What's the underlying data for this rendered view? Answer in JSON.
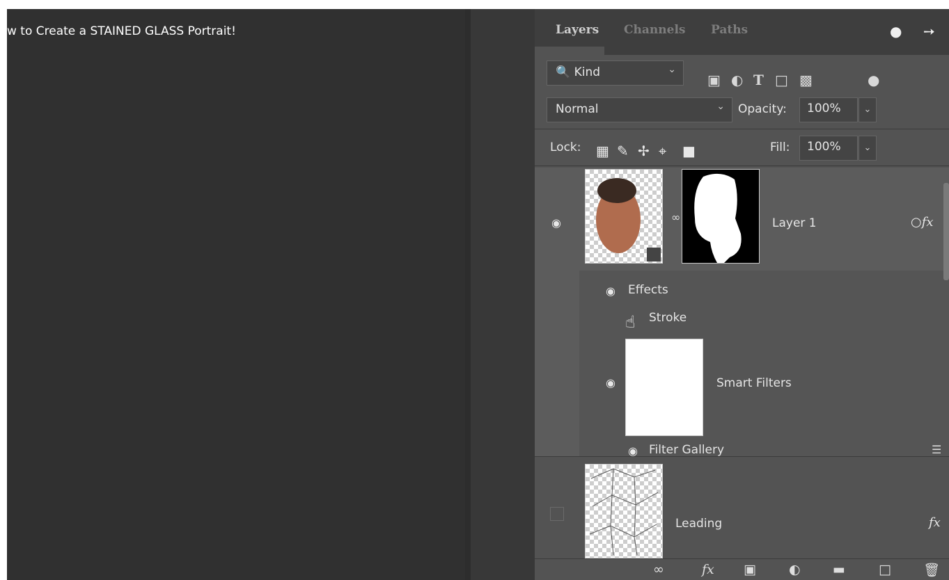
{
  "video": {
    "title": "w to Create a STAINED GLASS Portrait!"
  },
  "panel": {
    "tabs": [
      {
        "label": "Layers",
        "active": true
      },
      {
        "label": "Channels",
        "active": false
      },
      {
        "label": "Paths",
        "active": false
      }
    ],
    "header_icons": [
      "clock-icon",
      "share-arrow-icon"
    ],
    "filter": {
      "kind_label": "Kind",
      "filter_icons": [
        "pixel-layer-filter-icon",
        "adjustment-layer-filter-icon",
        "type-layer-filter-icon",
        "shape-layer-filter-icon",
        "smart-object-filter-icon",
        "filter-toggle-icon"
      ]
    },
    "blend": {
      "mode": "Normal",
      "opacity_label": "Opacity:",
      "opacity_value": "100%"
    },
    "lock": {
      "label": "Lock:",
      "fill_label": "Fill:",
      "fill_value": "100%",
      "icons": [
        "lock-transparent-pixels-icon",
        "lock-image-pixels-icon",
        "lock-position-icon",
        "lock-artboard-icon",
        "lock-all-icon"
      ]
    },
    "layers": [
      {
        "name": "Layer 1",
        "visible": true,
        "has_mask": true,
        "has_fx": true,
        "effects_label": "Effects",
        "stroke_label": "Stroke",
        "smart_filters_label": "Smart Filters",
        "filter_gallery_label": "Filter Gallery"
      },
      {
        "name": "Leading",
        "visible": false,
        "has_fx": true
      }
    ],
    "bottom_icons": [
      "link-layers-icon",
      "add-style-icon",
      "add-mask-icon",
      "new-adjustment-icon",
      "new-group-icon",
      "new-layer-icon",
      "delete-layer-icon"
    ]
  }
}
